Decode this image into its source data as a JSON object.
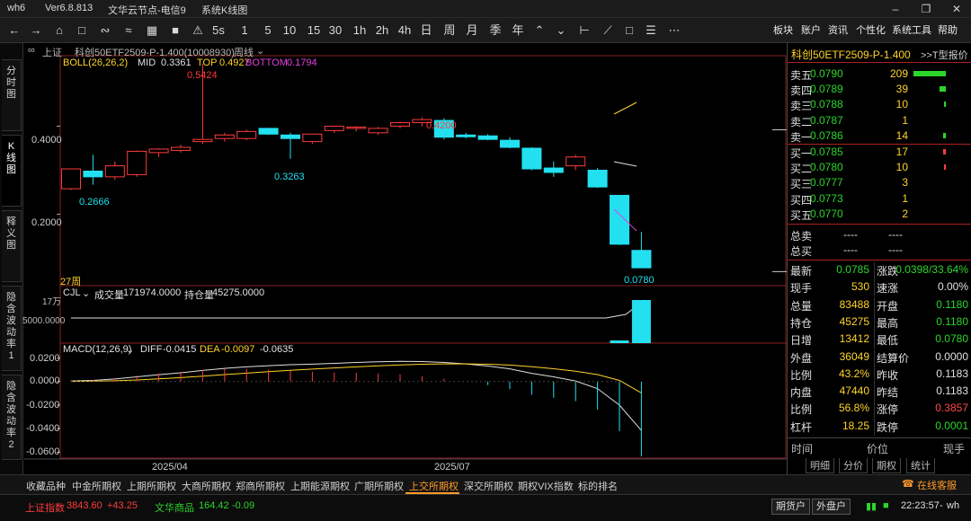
{
  "app": {
    "name": "wh6",
    "version": "Ver6.8.813",
    "server": "文华云节点-电信9",
    "window_title": "系统K线图"
  },
  "toolbar": {
    "periods": [
      "1",
      "5",
      "10",
      "15",
      "30",
      "1h",
      "2h",
      "4h",
      "日",
      "周",
      "月",
      "季",
      "年"
    ],
    "right_menu": [
      "板块",
      "账户",
      "资讯",
      "个性化",
      "系统工具",
      "帮助"
    ]
  },
  "chart_header": {
    "market": "上证",
    "contract": "科创50ETF2509-P-1.400(10008930)",
    "period": "周线"
  },
  "left_tabs": [
    "分时图",
    "K线图",
    "释义图",
    "隐含波动率1",
    "隐含波动率2"
  ],
  "boll": {
    "label": "BOLL(26,26,2)",
    "mid_label": "MID",
    "mid": "0.3361",
    "top_label": "TOP",
    "top": "0.4927",
    "bottom_label": "BOTTOM",
    "bottom": "0.1794"
  },
  "price_axis": [
    "0.4000",
    "0.2000"
  ],
  "price_annotations": {
    "high1": "0.5424",
    "high2": "0.4200",
    "low1": "0.2666",
    "low2": "0.3263",
    "last": "0.0780"
  },
  "bar_count": "27周",
  "volume": {
    "label": "CJL",
    "vol_label": "成交量",
    "vol": "171974.0000",
    "oi_label": "持仓量",
    "oi": "45275.0000",
    "axis_top": "17万",
    "axis_mid": "5000.0000"
  },
  "macd": {
    "label": "MACD(12,26,9)",
    "diff_label": "DIFF",
    "diff": "-0.0415",
    "dea_label": "DEA",
    "dea": "-0.0097",
    "macd_val": "-0.0635",
    "axis": [
      "0.0200",
      "0.0000",
      "-0.0200",
      "-0.0400",
      "-0.0600"
    ]
  },
  "x_axis": [
    "2025/04",
    "2025/07"
  ],
  "chart_data": {
    "type": "candlestick",
    "title": "科创50ETF2509-P-1.400",
    "period": "weekly",
    "price_ylim": [
      0.04,
      0.56
    ],
    "candles": [
      {
        "o": 0.258,
        "h": 0.3,
        "l": 0.255,
        "c": 0.303
      },
      {
        "o": 0.298,
        "h": 0.335,
        "l": 0.267,
        "c": 0.285
      },
      {
        "o": 0.285,
        "h": 0.32,
        "l": 0.278,
        "c": 0.31
      },
      {
        "o": 0.29,
        "h": 0.345,
        "l": 0.285,
        "c": 0.343
      },
      {
        "o": 0.34,
        "h": 0.35,
        "l": 0.33,
        "c": 0.348
      },
      {
        "o": 0.345,
        "h": 0.358,
        "l": 0.34,
        "c": 0.352
      },
      {
        "o": 0.365,
        "h": 0.542,
        "l": 0.36,
        "c": 0.37
      },
      {
        "o": 0.372,
        "h": 0.385,
        "l": 0.365,
        "c": 0.38
      },
      {
        "o": 0.372,
        "h": 0.392,
        "l": 0.368,
        "c": 0.388
      },
      {
        "o": 0.395,
        "h": 0.395,
        "l": 0.38,
        "c": 0.382
      },
      {
        "o": 0.38,
        "h": 0.385,
        "l": 0.326,
        "c": 0.372
      },
      {
        "o": 0.365,
        "h": 0.383,
        "l": 0.36,
        "c": 0.382
      },
      {
        "o": 0.39,
        "h": 0.4,
        "l": 0.385,
        "c": 0.4
      },
      {
        "o": 0.395,
        "h": 0.4,
        "l": 0.388,
        "c": 0.398
      },
      {
        "o": 0.385,
        "h": 0.398,
        "l": 0.38,
        "c": 0.395
      },
      {
        "o": 0.4,
        "h": 0.41,
        "l": 0.395,
        "c": 0.408
      },
      {
        "o": 0.408,
        "h": 0.42,
        "l": 0.4,
        "c": 0.415
      },
      {
        "o": 0.413,
        "h": 0.418,
        "l": 0.37,
        "c": 0.375
      },
      {
        "o": 0.38,
        "h": 0.385,
        "l": 0.372,
        "c": 0.376
      },
      {
        "o": 0.378,
        "h": 0.382,
        "l": 0.368,
        "c": 0.37
      },
      {
        "o": 0.368,
        "h": 0.375,
        "l": 0.35,
        "c": 0.352
      },
      {
        "o": 0.35,
        "h": 0.352,
        "l": 0.3,
        "c": 0.303
      },
      {
        "o": 0.305,
        "h": 0.32,
        "l": 0.285,
        "c": 0.295
      },
      {
        "o": 0.31,
        "h": 0.335,
        "l": 0.3,
        "c": 0.33
      },
      {
        "o": 0.3,
        "h": 0.305,
        "l": 0.26,
        "c": 0.262
      },
      {
        "o": 0.243,
        "h": 0.243,
        "l": 0.13,
        "c": 0.132
      },
      {
        "o": 0.118,
        "h": 0.16,
        "l": 0.078,
        "c": 0.0785
      }
    ],
    "boll_top_last": 0.4927,
    "boll_mid_last": 0.3361,
    "boll_bottom_last": 0.1794,
    "volume_last": 171974,
    "open_interest_last": 45275,
    "macd_ylim": [
      -0.065,
      0.025
    ],
    "diff_last": -0.0415,
    "dea_last": -0.0097,
    "macd_last": -0.0635,
    "x_ticks": [
      "2025/04",
      "2025/07"
    ]
  },
  "quote": {
    "title": "科创50ETF2509-P-1.400",
    "t_label": ">>T型报价",
    "asks": [
      {
        "label": "卖五",
        "price": "0.0790",
        "vol": "209",
        "bar": 1.0
      },
      {
        "label": "卖四",
        "price": "0.0789",
        "vol": "39",
        "bar": 0.2
      },
      {
        "label": "卖三",
        "price": "0.0788",
        "vol": "10",
        "bar": 0.05
      },
      {
        "label": "卖二",
        "price": "0.0787",
        "vol": "1",
        "bar": 0.0
      },
      {
        "label": "卖一",
        "price": "0.0786",
        "vol": "14",
        "bar": 0.07
      }
    ],
    "bids": [
      {
        "label": "买一",
        "price": "0.0785",
        "vol": "17",
        "bar": 0.08
      },
      {
        "label": "买二",
        "price": "0.0780",
        "vol": "10",
        "bar": 0.05
      },
      {
        "label": "买三",
        "price": "0.0777",
        "vol": "3",
        "bar": 0.0
      },
      {
        "label": "买四",
        "price": "0.0773",
        "vol": "1",
        "bar": 0.0
      },
      {
        "label": "买五",
        "price": "0.0770",
        "vol": "2",
        "bar": 0.0
      }
    ],
    "total_sell_label": "总卖",
    "total_sell_a": "----",
    "total_sell_b": "----",
    "total_buy_label": "总买",
    "total_buy_a": "----",
    "total_buy_b": "----",
    "stats": [
      {
        "l1": "最新",
        "v1": "0.0785",
        "c1": "#2cd52c",
        "l2": "涨跌",
        "v2": "0.0398/33.64%",
        "c2": "#2cd52c"
      },
      {
        "l1": "现手",
        "v1": "530",
        "c1": "#ffd42a",
        "l2": "速涨",
        "v2": "0.00%",
        "c2": "#e0e0e0"
      },
      {
        "l1": "总量",
        "v1": "83488",
        "c1": "#ffd42a",
        "l2": "开盘",
        "v2": "0.1180",
        "c2": "#2cd52c"
      },
      {
        "l1": "持仓",
        "v1": "45275",
        "c1": "#ffd42a",
        "l2": "最高",
        "v2": "0.1180",
        "c2": "#2cd52c"
      },
      {
        "l1": "日增",
        "v1": "13412",
        "c1": "#ffd42a",
        "l2": "最低",
        "v2": "0.0780",
        "c2": "#2cd52c"
      },
      {
        "l1": "外盘",
        "v1": "36049",
        "c1": "#ffd42a",
        "l2": "结算价",
        "v2": "0.0000",
        "c2": "#e0e0e0"
      },
      {
        "l1": "比例",
        "v1": "43.2%",
        "c1": "#ffd42a",
        "l2": "昨收",
        "v2": "0.1183",
        "c2": "#e0e0e0"
      },
      {
        "l1": "内盘",
        "v1": "47440",
        "c1": "#ffd42a",
        "l2": "昨结",
        "v2": "0.1183",
        "c2": "#e0e0e0"
      },
      {
        "l1": "比例",
        "v1": "56.8%",
        "c1": "#ffd42a",
        "l2": "涨停",
        "v2": "0.3857",
        "c2": "#ff4a4a"
      },
      {
        "l1": "杠杆",
        "v1": "18.25",
        "c1": "#ffd42a",
        "l2": "跌停",
        "v2": "0.0001",
        "c2": "#2cd52c"
      }
    ],
    "tick_headers": [
      "时间",
      "价位",
      "现手"
    ],
    "bottom_tabs": [
      "明细",
      "分价",
      "期权",
      "统计"
    ]
  },
  "bottom_tabs": [
    "收藏品种",
    "中金所期权",
    "上期所期权",
    "大商所期权",
    "郑商所期权",
    "上期能源期权",
    "广期所期权",
    "上交所期权",
    "深交所期权",
    "期权VIX指数",
    "标的排名"
  ],
  "bottom_tabs_active": "上交所期权",
  "status": {
    "idx1_name": "上证指数",
    "idx1_val": "3843.60",
    "idx1_chg": "+43.25",
    "idx2_name": "文华商品",
    "idx2_val": "164.42",
    "idx2_chg": "-0.09",
    "btn1": "期货户",
    "btn2": "外盘户",
    "time": "22:23:57",
    "user": "wh",
    "service": "在线客服"
  },
  "colors": {
    "up": "#ff3b3b",
    "down": "#22e0f0",
    "accent": "#ff9a2a",
    "boll_mid": "#e0e0e0",
    "boll_top": "#ffd42a",
    "boll_bottom": "#e040e0"
  }
}
